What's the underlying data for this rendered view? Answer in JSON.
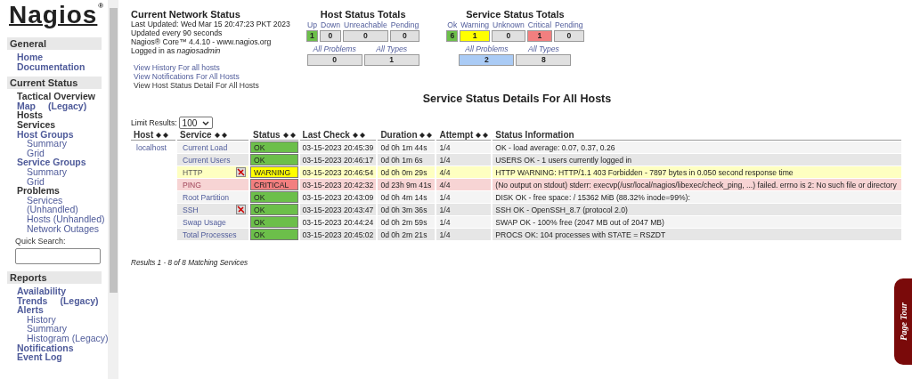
{
  "logo": {
    "text": "Nagios",
    "mark": "®"
  },
  "sidebar": {
    "sections": [
      {
        "title": "General",
        "items": [
          {
            "label": "Home",
            "kind": "link"
          },
          {
            "label": "Documentation",
            "kind": "link"
          }
        ]
      },
      {
        "title": "Current Status",
        "items": [
          {
            "label": "Tactical Overview",
            "kind": "plain"
          },
          {
            "label": "Map",
            "suffix": "(Legacy)",
            "kind": "link"
          },
          {
            "label": "Hosts",
            "kind": "plain"
          },
          {
            "label": "Services",
            "kind": "plain"
          },
          {
            "label": "Host Groups",
            "kind": "link",
            "children": [
              {
                "label": "Summary"
              },
              {
                "label": "Grid"
              }
            ]
          },
          {
            "label": "Service Groups",
            "kind": "link",
            "children": [
              {
                "label": "Summary"
              },
              {
                "label": "Grid"
              }
            ]
          },
          {
            "label": "Problems",
            "kind": "plain",
            "children": [
              {
                "label": "Services"
              },
              {
                "label": "(Unhandled)"
              },
              {
                "label": "Hosts (Unhandled)"
              },
              {
                "label": "Network Outages"
              }
            ]
          }
        ],
        "search": {
          "label": "Quick Search:"
        }
      },
      {
        "title": "Reports",
        "items": [
          {
            "label": "Availability",
            "kind": "link"
          },
          {
            "label": "Trends",
            "suffix": "(Legacy)",
            "kind": "link"
          },
          {
            "label": "Alerts",
            "kind": "link",
            "children": [
              {
                "label": "History"
              },
              {
                "label": "Summary"
              },
              {
                "label": "Histogram (Legacy)"
              }
            ]
          },
          {
            "label": "Notifications",
            "kind": "link"
          },
          {
            "label": "Event Log",
            "kind": "link"
          }
        ]
      }
    ]
  },
  "network_status": {
    "title": "Current Network Status",
    "lines": [
      "Last Updated: Wed Mar 15 20:47:23 PKT 2023",
      "Updated every 90 seconds",
      "Nagios® Core™ 4.4.10 - www.nagios.org"
    ],
    "logged_in": "Logged in as *nagiosadmin*",
    "links": [
      "View History For all hosts",
      "View Notifications For All Hosts",
      "View Host Status Detail For All Hosts"
    ]
  },
  "host_totals": {
    "title": "Host Status Totals",
    "counts": [
      {
        "label": "Up",
        "value": "1",
        "color": "#6cbf4a"
      },
      {
        "label": "Down",
        "value": "0",
        "color": "#e0e0e0"
      },
      {
        "label": "Unreachable",
        "value": "0",
        "color": "#e0e0e0"
      },
      {
        "label": "Pending",
        "value": "0",
        "color": "#e0e0e0"
      }
    ],
    "summary": [
      {
        "label": "All Problems",
        "value": "0",
        "color": "#e0e0e0"
      },
      {
        "label": "All Types",
        "value": "1",
        "color": "#e0e0e0"
      }
    ]
  },
  "service_totals": {
    "title": "Service Status Totals",
    "counts": [
      {
        "label": "Ok",
        "value": "6",
        "color": "#6cbf4a"
      },
      {
        "label": "Warning",
        "value": "1",
        "color": "#ffff00"
      },
      {
        "label": "Unknown",
        "value": "0",
        "color": "#e0e0e0"
      },
      {
        "label": "Critical",
        "value": "1",
        "color": "#f27f7f"
      },
      {
        "label": "Pending",
        "value": "0",
        "color": "#e0e0e0"
      }
    ],
    "summary": [
      {
        "label": "All Problems",
        "value": "2",
        "color": "#aacbf5"
      },
      {
        "label": "All Types",
        "value": "8",
        "color": "#e0e0e0"
      }
    ]
  },
  "details": {
    "title": "Service Status Details For All Hosts",
    "limit_label": "Limit Results:",
    "limit_value": "100",
    "columns": [
      {
        "label": "Host",
        "sortable": true
      },
      {
        "label": "Service",
        "sortable": true
      },
      {
        "label": "Status",
        "sortable": true
      },
      {
        "label": "Last Check",
        "sortable": true
      },
      {
        "label": "Duration",
        "sortable": true
      },
      {
        "label": "Attempt",
        "sortable": true
      },
      {
        "label": "Status Information",
        "sortable": false
      }
    ],
    "rows": [
      {
        "host": "localhost",
        "service": "Current Load",
        "notifications_disabled": false,
        "status": "OK",
        "kind": "ok",
        "last_check": "03-15-2023 20:45:39",
        "duration": "0d 0h 1m 44s",
        "attempt": "1/4",
        "info": "OK - load average: 0.07, 0.37, 0.26"
      },
      {
        "service": "Current Users",
        "notifications_disabled": false,
        "status": "OK",
        "kind": "ok",
        "last_check": "03-15-2023 20:46:17",
        "duration": "0d 0h 1m 6s",
        "attempt": "1/4",
        "info": "USERS OK - 1 users currently logged in"
      },
      {
        "service": "HTTP",
        "notifications_disabled": true,
        "status": "WARNING",
        "kind": "warning",
        "last_check": "03-15-2023 20:46:54",
        "duration": "0d 0h 0m 29s",
        "attempt": "4/4",
        "info": "HTTP WARNING: HTTP/1.1 403 Forbidden - 7897 bytes in 0.050 second response time"
      },
      {
        "service": "PING",
        "notifications_disabled": false,
        "status": "CRITICAL",
        "kind": "critical",
        "last_check": "03-15-2023 20:42:32",
        "duration": "0d 23h 9m 41s",
        "attempt": "4/4",
        "info": "(No output on stdout) stderr: execvp(/usr/local/nagios/libexec/check_ping, ...) failed. errno is 2: No such file or directory"
      },
      {
        "service": "Root Partition",
        "notifications_disabled": false,
        "status": "OK",
        "kind": "ok",
        "last_check": "03-15-2023 20:43:09",
        "duration": "0d 0h 4m 14s",
        "attempt": "1/4",
        "info": "DISK OK - free space: / 15362 MiB (88.32% inode=99%):"
      },
      {
        "service": "SSH",
        "notifications_disabled": true,
        "status": "OK",
        "kind": "ok",
        "last_check": "03-15-2023 20:43:47",
        "duration": "0d 0h 3m 36s",
        "attempt": "1/4",
        "info": "SSH OK - OpenSSH_8.7 (protocol 2.0)"
      },
      {
        "service": "Swap Usage",
        "notifications_disabled": false,
        "status": "OK",
        "kind": "ok",
        "last_check": "03-15-2023 20:44:24",
        "duration": "0d 0h 2m 59s",
        "attempt": "1/4",
        "info": "SWAP OK - 100% free (2047 MB out of 2047 MB)"
      },
      {
        "service": "Total Processes",
        "notifications_disabled": false,
        "status": "OK",
        "kind": "ok",
        "last_check": "03-15-2023 20:45:02",
        "duration": "0d 0h 2m 21s",
        "attempt": "1/4",
        "info": "PROCS OK: 104 processes with STATE = RSZDT"
      }
    ],
    "results": "Results 1 - 8 of 8 Matching Services"
  },
  "page_tour": {
    "label": "Page Tour"
  }
}
